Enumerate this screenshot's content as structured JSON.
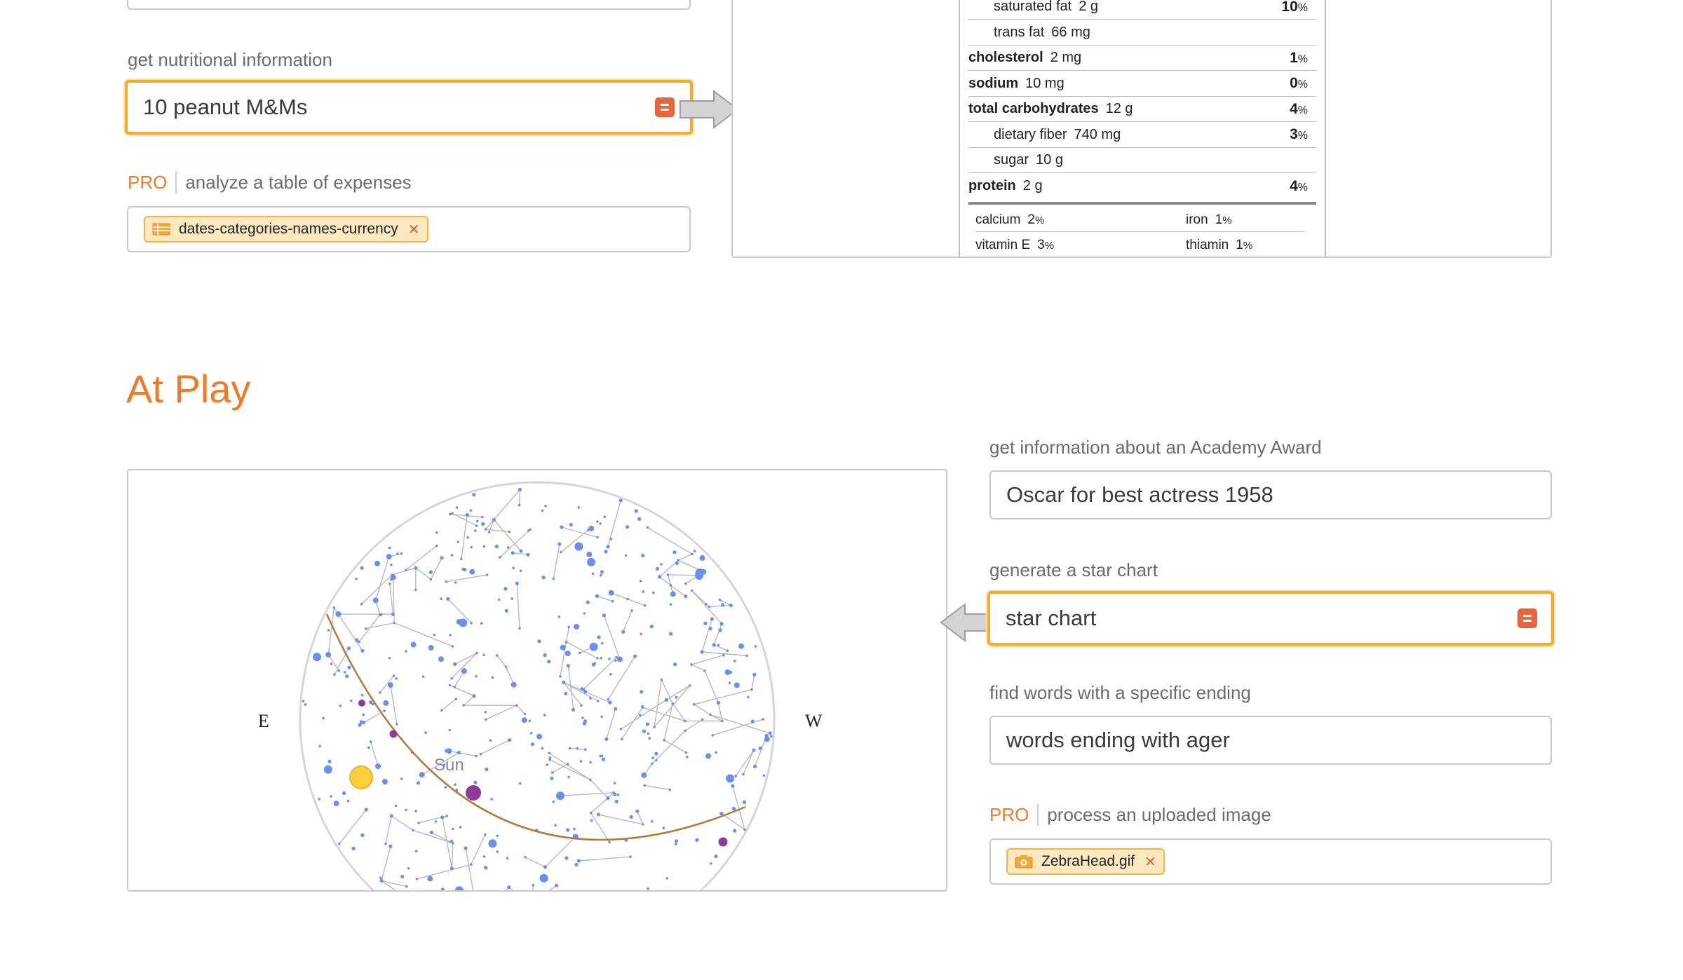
{
  "nutrition_section": {
    "nutrition_label": "get nutritional information",
    "nutrition_input": "10 peanut M&Ms",
    "expenses_pro": "PRO",
    "expenses_label": "analyze a table of expenses",
    "expenses_file": "dates-categories-names-currency",
    "nutrition_facts": [
      {
        "name": "saturated fat",
        "amount": "2 g",
        "pct": "10",
        "bold": false,
        "indent": true
      },
      {
        "name": "trans fat",
        "amount": "66 mg",
        "pct": "",
        "bold": false,
        "indent": true
      },
      {
        "name": "cholesterol",
        "amount": "2 mg",
        "pct": "1",
        "bold": true,
        "indent": false
      },
      {
        "name": "sodium",
        "amount": "10 mg",
        "pct": "0",
        "bold": true,
        "indent": false
      },
      {
        "name": "total carbohydrates",
        "amount": "12 g",
        "pct": "4",
        "bold": true,
        "indent": false
      },
      {
        "name": "dietary fiber",
        "amount": "740 mg",
        "pct": "3",
        "bold": false,
        "indent": true
      },
      {
        "name": "sugar",
        "amount": "10 g",
        "pct": "",
        "bold": false,
        "indent": true
      },
      {
        "name": "protein",
        "amount": "2 g",
        "pct": "4",
        "bold": true,
        "indent": false
      }
    ],
    "percent_sign": "%",
    "vitamins": [
      {
        "name": "calcium",
        "pct": "2"
      },
      {
        "name": "iron",
        "pct": "1"
      },
      {
        "name": "vitamin E",
        "pct": "3"
      },
      {
        "name": "thiamin",
        "pct": "1"
      }
    ]
  },
  "at_play": {
    "title": "At Play",
    "star_chart": {
      "east": "E",
      "west": "W",
      "sun_label": "Sun"
    },
    "academy_label": "get information about an Academy Award",
    "academy_input": "Oscar for best actress 1958",
    "star_label": "generate a star chart",
    "star_input": "star chart",
    "words_label": "find words with a specific ending",
    "words_input": "words ending with ager",
    "image_pro": "PRO",
    "image_label": "process an uploaded image",
    "image_file": "ZebraHead.gif"
  },
  "colors": {
    "accent_orange": "#ef7b28",
    "active_border": "#f5ac2e",
    "star_blue": "#6b8ff0",
    "planet_purple": "#8e3a9c",
    "sun_yellow": "#fcd03c"
  }
}
